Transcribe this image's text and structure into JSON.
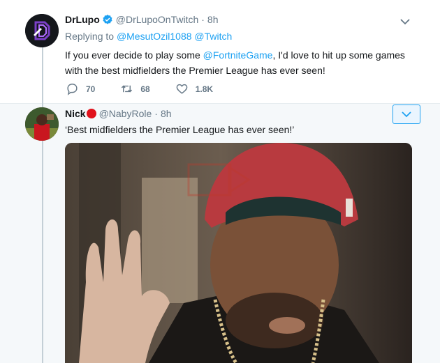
{
  "tweet1": {
    "display_name": "DrLupo",
    "handle": "@DrLupoOnTwitch",
    "separator": "·",
    "time": "8h",
    "replying_label": "Replying to",
    "replying_to": [
      "@MesutOzil1088",
      "@Twitch"
    ],
    "text_before": "If you ever decide to play some ",
    "text_mention": "@FortniteGame",
    "text_after": ", I'd love to hit up some games with the best midfielders the Premier League has ever seen!",
    "replies": "70",
    "retweets": "68",
    "likes": "1.8K"
  },
  "tweet2": {
    "display_name": "Nick",
    "handle": "@NabyRole",
    "separator": "·",
    "time": "8h",
    "text": "‘Best midfielders the Premier League has ever seen!’"
  },
  "colors": {
    "link": "#1da1f2",
    "secondary_text": "#657786",
    "thread_line": "#c4cfd6",
    "reply_bg": "#f5f8fa",
    "red_indicator": "#e0111b"
  },
  "icons": [
    "verified-badge-icon",
    "reply-icon",
    "retweet-icon",
    "like-icon",
    "chevron-down-icon"
  ]
}
